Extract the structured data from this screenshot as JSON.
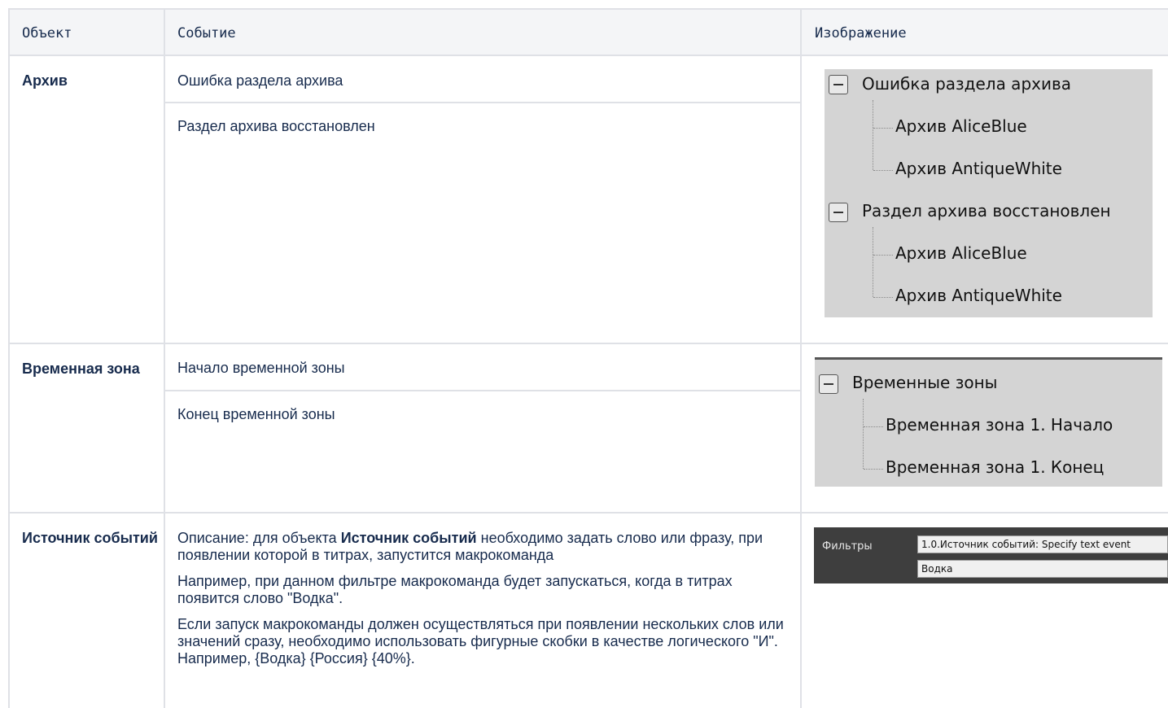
{
  "header": {
    "object": "Объект",
    "event": "Событие",
    "image": "Изображение"
  },
  "rows": [
    {
      "object": "Архив",
      "events": [
        "Ошибка раздела архива",
        "Раздел архива восстановлен"
      ],
      "tree": {
        "groups": [
          {
            "title": "Ошибка раздела архива",
            "children": [
              "Архив AliceBlue",
              "Архив AntiqueWhite"
            ]
          },
          {
            "title": "Раздел архива восстановлен",
            "children": [
              "Архив AliceBlue",
              "Архив AntiqueWhite"
            ]
          }
        ]
      }
    },
    {
      "object": "Временная зона",
      "events": [
        "Начало временной зоны",
        "Конец временной зоны"
      ],
      "tree": {
        "groups": [
          {
            "title": "Временные зоны",
            "children": [
              "Временная зона 1. Начало",
              "Временная зона 1. Конец"
            ]
          }
        ]
      }
    },
    {
      "object": "Источник событий",
      "description": {
        "p1_prefix": "Описание: для объекта ",
        "p1_bold": "Источник событий",
        "p1_suffix": " необходимо задать слово или фразу, при появлении которой в титрах, запустится макрокоманда",
        "p2": "Например, при данном фильтре макрокоманда будет запускаться, когда в титрах появится слово \"Водка\".",
        "p3": "Если запуск макрокоманды должен осуществляться при появлении нескольких слов или значений сразу, необходимо использовать фигурные скобки в качестве логического \"И\". Например, {Водка} {Россия} {40%}."
      },
      "filter": {
        "label": "Фильтры",
        "line1": "1.0.Источник событий: Specify text event",
        "line2": "Водка"
      }
    }
  ],
  "colors": {
    "border": "#dfe1e6",
    "header_bg": "#f4f5f7",
    "text": "#172b4d",
    "tree_bg": "#d4d4d4",
    "filter_bg": "#3e3e3e"
  }
}
